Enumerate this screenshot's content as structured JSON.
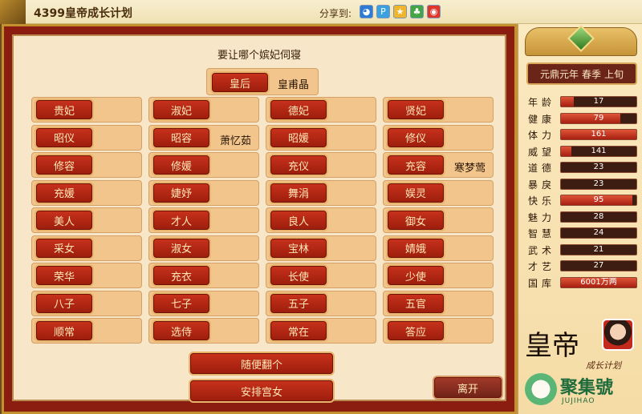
{
  "topbar": {
    "title": "4399皇帝成长计划",
    "share_label": "分享到:",
    "share_icons": [
      "qq-icon",
      "qzone-icon",
      "star-icon",
      "clover-icon",
      "weibo-icon"
    ]
  },
  "main": {
    "prompt": "要让哪个嫔妃伺寝",
    "queen": {
      "rank": "皇后",
      "occupant": "皇甫晶"
    },
    "rows": [
      [
        {
          "rank": "贵妃",
          "occupant": ""
        },
        {
          "rank": "淑妃",
          "occupant": ""
        },
        {
          "rank": "德妃",
          "occupant": ""
        },
        {
          "rank": "贤妃",
          "occupant": ""
        }
      ],
      [
        {
          "rank": "昭仪",
          "occupant": ""
        },
        {
          "rank": "昭容",
          "occupant": "萧忆茹"
        },
        {
          "rank": "昭媛",
          "occupant": ""
        },
        {
          "rank": "修仪",
          "occupant": ""
        }
      ],
      [
        {
          "rank": "修容",
          "occupant": ""
        },
        {
          "rank": "修媛",
          "occupant": ""
        },
        {
          "rank": "充仪",
          "occupant": ""
        },
        {
          "rank": "充容",
          "occupant": "寒梦莺"
        }
      ],
      [
        {
          "rank": "充媛",
          "occupant": ""
        },
        {
          "rank": "婕妤",
          "occupant": ""
        },
        {
          "rank": "舞涓",
          "occupant": ""
        },
        {
          "rank": "娱灵",
          "occupant": ""
        }
      ],
      [
        {
          "rank": "美人",
          "occupant": ""
        },
        {
          "rank": "才人",
          "occupant": ""
        },
        {
          "rank": "良人",
          "occupant": ""
        },
        {
          "rank": "御女",
          "occupant": ""
        }
      ],
      [
        {
          "rank": "采女",
          "occupant": ""
        },
        {
          "rank": "淑女",
          "occupant": ""
        },
        {
          "rank": "宝林",
          "occupant": ""
        },
        {
          "rank": "婧娥",
          "occupant": ""
        }
      ],
      [
        {
          "rank": "荣华",
          "occupant": ""
        },
        {
          "rank": "充衣",
          "occupant": ""
        },
        {
          "rank": "长使",
          "occupant": ""
        },
        {
          "rank": "少使",
          "occupant": ""
        }
      ],
      [
        {
          "rank": "八子",
          "occupant": ""
        },
        {
          "rank": "七子",
          "occupant": ""
        },
        {
          "rank": "五子",
          "occupant": ""
        },
        {
          "rank": "五官",
          "occupant": ""
        }
      ],
      [
        {
          "rank": "顺常",
          "occupant": ""
        },
        {
          "rank": "选侍",
          "occupant": ""
        },
        {
          "rank": "常在",
          "occupant": ""
        },
        {
          "rank": "答应",
          "occupant": ""
        }
      ]
    ],
    "random_label": "随便翻个",
    "arrange_label": "安排宫女",
    "leave_label": "离开"
  },
  "side": {
    "date": {
      "era": "元鼎元年",
      "season": "春季",
      "period": "上旬"
    },
    "stats": [
      {
        "label": "年龄",
        "value": "17",
        "fill": 0.17
      },
      {
        "label": "健康",
        "value": "79",
        "fill": 0.79
      },
      {
        "label": "体力",
        "value": "161",
        "fill": 1.0
      },
      {
        "label": "威望",
        "value": "141",
        "fill": 0.14
      },
      {
        "label": "道德",
        "value": "23",
        "fill": 0.0
      },
      {
        "label": "暴戾",
        "value": "23",
        "fill": 0.0
      },
      {
        "label": "快乐",
        "value": "95",
        "fill": 0.95
      },
      {
        "label": "魅力",
        "value": "28",
        "fill": 0.0
      },
      {
        "label": "智慧",
        "value": "24",
        "fill": 0.0
      },
      {
        "label": "武术",
        "value": "21",
        "fill": 0.0
      },
      {
        "label": "才艺",
        "value": "27",
        "fill": 0.0
      },
      {
        "label": "国库",
        "value": "6001万两",
        "fill": 1.0
      }
    ],
    "brand": {
      "title": "皇帝",
      "subtitle": "成长计划",
      "watermark": "聚集號",
      "watermark_sub": "JUJIHAO"
    }
  },
  "colors": {
    "button_red": "#b82a16",
    "slot_bg": "#f1c58c",
    "frame_red": "#8a1d10",
    "bar_fill": "#c23a22"
  }
}
